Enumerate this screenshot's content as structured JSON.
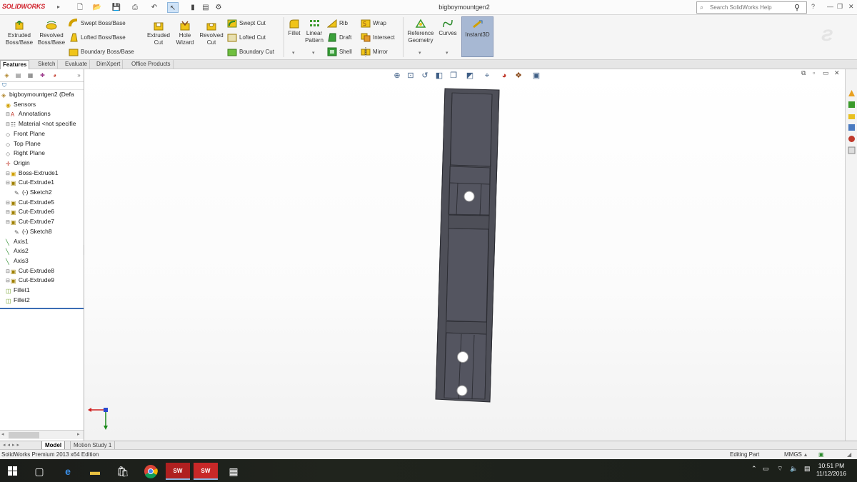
{
  "app": {
    "logo": "SOLIDWORKS",
    "document_title": "bigboymountgen2"
  },
  "search": {
    "placeholder": "Search SolidWorks Help"
  },
  "ribbon": {
    "extruded_boss": "Extruded Boss/Base",
    "revolved_boss": "Revolved Boss/Base",
    "swept_boss": "Swept Boss/Base",
    "lofted_boss": "Lofted Boss/Base",
    "boundary_boss": "Boundary Boss/Base",
    "extruded_cut": "Extruded Cut",
    "hole_wizard": "Hole Wizard",
    "revolved_cut": "Revolved Cut",
    "swept_cut": "Swept Cut",
    "lofted_cut": "Lofted Cut",
    "boundary_cut": "Boundary Cut",
    "fillet": "Fillet",
    "linear_pattern": "Linear Pattern",
    "rib": "Rib",
    "draft": "Draft",
    "shell": "Shell",
    "wrap": "Wrap",
    "intersect": "Intersect",
    "mirror": "Mirror",
    "reference_geometry": "Reference Geometry",
    "curves": "Curves",
    "instant3d": "Instant3D"
  },
  "command_tabs": [
    "Features",
    "Sketch",
    "Evaluate",
    "DimXpert",
    "Office Products"
  ],
  "feature_tree": [
    {
      "label": "bigboymountgen2  (Defa",
      "icon": "part-icon"
    },
    {
      "label": "Sensors",
      "icon": "sensor-icon"
    },
    {
      "label": "Annotations",
      "icon": "annotation-icon"
    },
    {
      "label": "Material <not specifie",
      "icon": "material-icon"
    },
    {
      "label": "Front Plane",
      "icon": "plane-icon"
    },
    {
      "label": "Top Plane",
      "icon": "plane-icon"
    },
    {
      "label": "Right Plane",
      "icon": "plane-icon"
    },
    {
      "label": "Origin",
      "icon": "origin-icon"
    },
    {
      "label": "Boss-Extrude1",
      "icon": "extrude-icon"
    },
    {
      "label": "Cut-Extrude1",
      "icon": "cut-icon"
    },
    {
      "label": "(-) Sketch2",
      "icon": "sketch-icon"
    },
    {
      "label": "Cut-Extrude5",
      "icon": "cut-icon"
    },
    {
      "label": "Cut-Extrude6",
      "icon": "cut-icon"
    },
    {
      "label": "Cut-Extrude7",
      "icon": "cut-icon"
    },
    {
      "label": "(-) Sketch8",
      "icon": "sketch-icon"
    },
    {
      "label": "Axis1",
      "icon": "axis-icon"
    },
    {
      "label": "Axis2",
      "icon": "axis-icon"
    },
    {
      "label": "Axis3",
      "icon": "axis-icon"
    },
    {
      "label": "Cut-Extrude8",
      "icon": "cut-icon"
    },
    {
      "label": "Cut-Extrude9",
      "icon": "cut-icon"
    },
    {
      "label": "Fillet1",
      "icon": "fillet-icon"
    },
    {
      "label": "Fillet2",
      "icon": "fillet-icon"
    }
  ],
  "bottom_tabs": [
    "Model",
    "Motion Study 1"
  ],
  "status": {
    "edition": "SolidWorks Premium 2013 x64 Edition",
    "mode": "Editing Part",
    "units": "MMGS"
  },
  "taskbar": {
    "time": "10:51 PM",
    "date": "11/12/2016"
  },
  "colors": {
    "model_fill": "#4e4f58",
    "model_edge": "#2c2d33",
    "accent": "#3b6db4",
    "logo_red": "#d0202a"
  }
}
